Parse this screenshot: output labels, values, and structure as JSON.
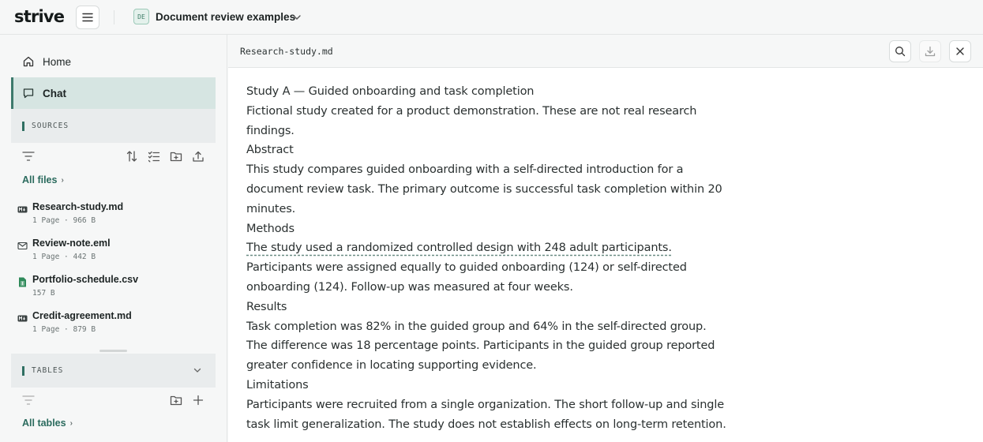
{
  "topbar": {
    "logo": "strive",
    "workspace_badge": "DE",
    "workspace_title": "Document review examples"
  },
  "sidebar": {
    "nav": [
      {
        "label": "Home",
        "icon": "home-icon"
      },
      {
        "label": "Chat",
        "icon": "chat-icon"
      }
    ],
    "sources_label": "SOURCES",
    "all_files_label": "All files",
    "files": [
      {
        "name": "Research-study.md",
        "meta": "1 Page  ·  966 B",
        "icon": "markdown-icon"
      },
      {
        "name": "Review-note.eml",
        "meta": "1 Page  ·  442 B",
        "icon": "mail-icon"
      },
      {
        "name": "Portfolio-schedule.csv",
        "meta": "157 B",
        "icon": "spreadsheet-icon"
      },
      {
        "name": "Credit-agreement.md",
        "meta": "1 Page  ·  879 B",
        "icon": "markdown-icon"
      }
    ],
    "tables_label": "TABLES",
    "all_tables_label": "All tables"
  },
  "document": {
    "filename": "Research-study.md",
    "lines": [
      "Study A — Guided onboarding and task completion",
      "Fictional study created for a product demonstration. These are not real research findings.",
      "Abstract",
      "This study compares guided onboarding with a self-directed introduction for a document review task. The primary outcome is successful task completion within 20 minutes.",
      "Methods",
      "The study used a randomized controlled design with 248 adult participants.",
      "Participants were assigned equally to guided onboarding (124) or self-directed onboarding (124). Follow-up was measured at four weeks.",
      "Results",
      "Task completion was 82% in the guided group and 64% in the self-directed group.",
      "The difference was 18 percentage points. Participants in the guided group reported greater confidence in locating supporting evidence.",
      "Limitations",
      "Participants were recruited from a single organization. The short follow-up and single task limit generalization. The study does not establish effects on long-term retention."
    ]
  },
  "colors": {
    "accent": "#2f6f62",
    "active_nav_bg": "#d6e5e2"
  }
}
